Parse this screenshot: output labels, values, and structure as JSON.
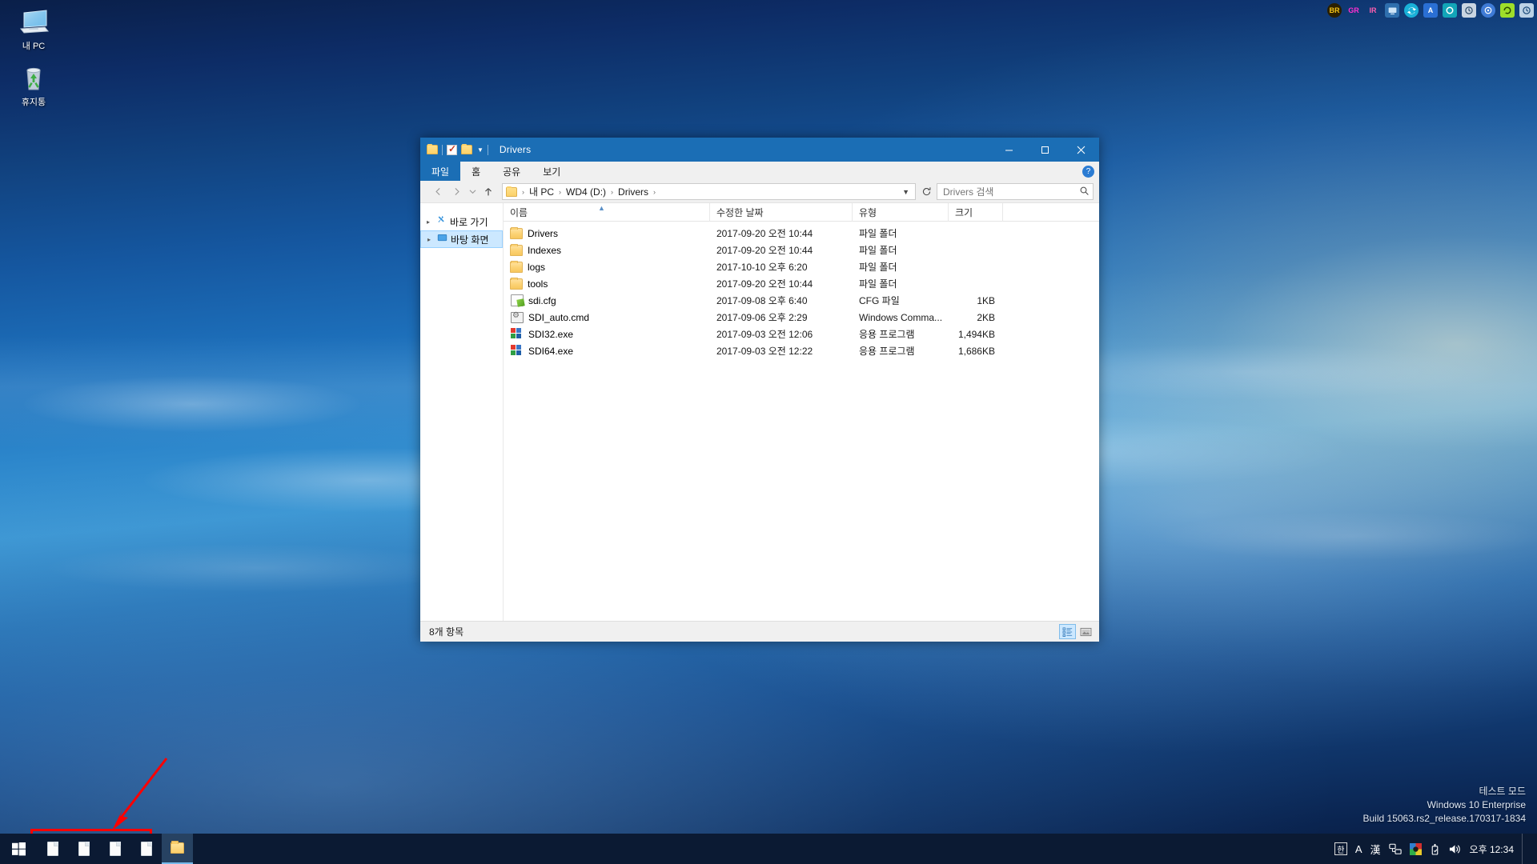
{
  "desktop": {
    "icons": [
      {
        "name": "this-pc",
        "label": "내 PC",
        "icon": "monitor-icon"
      },
      {
        "name": "recycle-bin",
        "label": "휴지통",
        "icon": "recycle-bin-icon"
      }
    ],
    "top_icon_row": [
      {
        "name": "br-icon",
        "label": "BR",
        "color": "#f5c518",
        "bg": "#3b2a00"
      },
      {
        "name": "gr-icon",
        "label": "GR",
        "color": "#ff2fd0",
        "bg": "transparent"
      },
      {
        "name": "ir-icon",
        "label": "IR",
        "color": "#ff5fb0",
        "bg": "transparent"
      },
      {
        "name": "remote-desktop-icon",
        "label": "",
        "color": "#cfe4f7",
        "bg": "#2f6fae"
      },
      {
        "name": "sync-icon",
        "label": "",
        "color": "#ffffff",
        "bg": "#19b0d8"
      },
      {
        "name": "acronis-icon",
        "label": "A",
        "color": "#ffffff",
        "bg": "#2a6fd4"
      },
      {
        "name": "camera-icon",
        "label": "",
        "color": "#ffffff",
        "bg": "#12a5b8"
      },
      {
        "name": "backup-history-icon",
        "label": "",
        "color": "#2a4a6a",
        "bg": "#cfd9e3"
      },
      {
        "name": "disk-tool-icon",
        "label": "",
        "color": "#ffffff",
        "bg": "#3f7bd6"
      },
      {
        "name": "green-disk-icon",
        "label": "",
        "color": "#2a4a00",
        "bg": "#9ede2a"
      },
      {
        "name": "restore-point-icon",
        "label": "",
        "color": "#1b4a7a",
        "bg": "#bcd2e6"
      }
    ]
  },
  "window": {
    "title": "Drivers",
    "quick_access_toolbar": [
      {
        "name": "qat-folder-icon",
        "label": "folder-icon"
      },
      {
        "name": "qat-properties-icon",
        "label": "properties-icon"
      },
      {
        "name": "qat-new-folder-icon",
        "label": "new-folder-icon"
      },
      {
        "name": "qat-customize-icon",
        "label": "chevron-down-icon"
      }
    ],
    "controls": {
      "minimize": "–",
      "maximize": "☐",
      "close": "✕"
    },
    "ribbon_tabs": [
      {
        "name": "tab-file",
        "label": "파일",
        "active": false
      },
      {
        "name": "tab-home",
        "label": "홈",
        "active": false
      },
      {
        "name": "tab-share",
        "label": "공유",
        "active": false
      },
      {
        "name": "tab-view",
        "label": "보기",
        "active": true
      }
    ],
    "help_label": "?",
    "nav": {
      "back": "←",
      "forward": "→",
      "recent": "⌄",
      "up": "↑"
    },
    "breadcrumb": {
      "icon": "folder-icon",
      "parts": [
        "내 PC",
        "WD4 (D:)",
        "Drivers"
      ],
      "separator": "›",
      "dropdown": "⌄"
    },
    "refresh_label": "⟳",
    "search": {
      "placeholder": "Drivers 검색",
      "value": "",
      "icon": "search-icon"
    },
    "nav_pane": [
      {
        "name": "sidebar-item-quick-access",
        "label": "바로 가기",
        "icon": "pin-icon",
        "selected": false,
        "expandable": true
      },
      {
        "name": "sidebar-item-desktop",
        "label": "바탕 화면",
        "icon": "desktop-icon",
        "selected": true,
        "expandable": true
      }
    ],
    "columns": [
      {
        "name": "column-name",
        "label": "이름",
        "sorted": true,
        "sort_dir": "asc"
      },
      {
        "name": "column-date-modified",
        "label": "수정한 날짜",
        "sorted": false
      },
      {
        "name": "column-type",
        "label": "유형",
        "sorted": false
      },
      {
        "name": "column-size",
        "label": "크기",
        "sorted": false
      }
    ],
    "files": [
      {
        "name": "Drivers",
        "date": "2017-09-20 오전 10:44",
        "type": "파일 폴더",
        "size": "",
        "icon": "folder-icon"
      },
      {
        "name": "Indexes",
        "date": "2017-09-20 오전 10:44",
        "type": "파일 폴더",
        "size": "",
        "icon": "folder-icon"
      },
      {
        "name": "logs",
        "date": "2017-10-10 오후 6:20",
        "type": "파일 폴더",
        "size": "",
        "icon": "folder-icon"
      },
      {
        "name": "tools",
        "date": "2017-09-20 오전 10:44",
        "type": "파일 폴더",
        "size": "",
        "icon": "folder-icon"
      },
      {
        "name": "sdi.cfg",
        "date": "2017-09-08 오후 6:40",
        "type": "CFG 파일",
        "size": "1KB",
        "icon": "cfg-file-icon"
      },
      {
        "name": "SDI_auto.cmd",
        "date": "2017-09-06 오후 2:29",
        "type": "Windows Comma...",
        "size": "2KB",
        "icon": "cmd-file-icon"
      },
      {
        "name": "SDI32.exe",
        "date": "2017-09-03 오전 12:06",
        "type": "응용 프로그램",
        "size": "1,494KB",
        "icon": "exe-file-icon"
      },
      {
        "name": "SDI64.exe",
        "date": "2017-09-03 오전 12:22",
        "type": "응용 프로그램",
        "size": "1,686KB",
        "icon": "exe-file-icon"
      }
    ],
    "status": {
      "item_count": "8개 항목",
      "views": [
        {
          "name": "details-view-button",
          "label": "details-view-icon",
          "selected": true
        },
        {
          "name": "large-icons-view-button",
          "label": "large-icons-view-icon",
          "selected": false
        }
      ]
    }
  },
  "taskbar": {
    "start": {
      "name": "start-button",
      "label": "windows-logo-icon"
    },
    "items": [
      {
        "name": "taskbar-item-doc-1",
        "icon": "document-icon",
        "active": false
      },
      {
        "name": "taskbar-item-doc-2",
        "icon": "document-icon",
        "active": false
      },
      {
        "name": "taskbar-item-doc-3",
        "icon": "document-icon",
        "active": false
      },
      {
        "name": "taskbar-item-doc-4",
        "icon": "document-icon",
        "active": false
      },
      {
        "name": "taskbar-item-explorer",
        "icon": "folder-icon",
        "active": true
      }
    ],
    "tray": [
      {
        "name": "ime-korean-icon",
        "label": "한"
      },
      {
        "name": "ime-alpha-icon",
        "label": "A"
      },
      {
        "name": "ime-hanja-icon",
        "label": "漢"
      },
      {
        "name": "network-icon",
        "label": "network-icon"
      },
      {
        "name": "color-profile-icon",
        "label": "color-icon"
      },
      {
        "name": "usb-eject-icon",
        "label": "usb-icon"
      },
      {
        "name": "volume-icon",
        "label": "volume-icon"
      }
    ],
    "clock": "오후 12:34"
  },
  "watermark": {
    "line1": "테스트 모드",
    "line2": "Windows 10 Enterprise",
    "line3": "Build 15063.rs2_release.170317-1834"
  },
  "annotation": {
    "arrow_color": "#ff0000",
    "box_color": "#ff0000"
  }
}
